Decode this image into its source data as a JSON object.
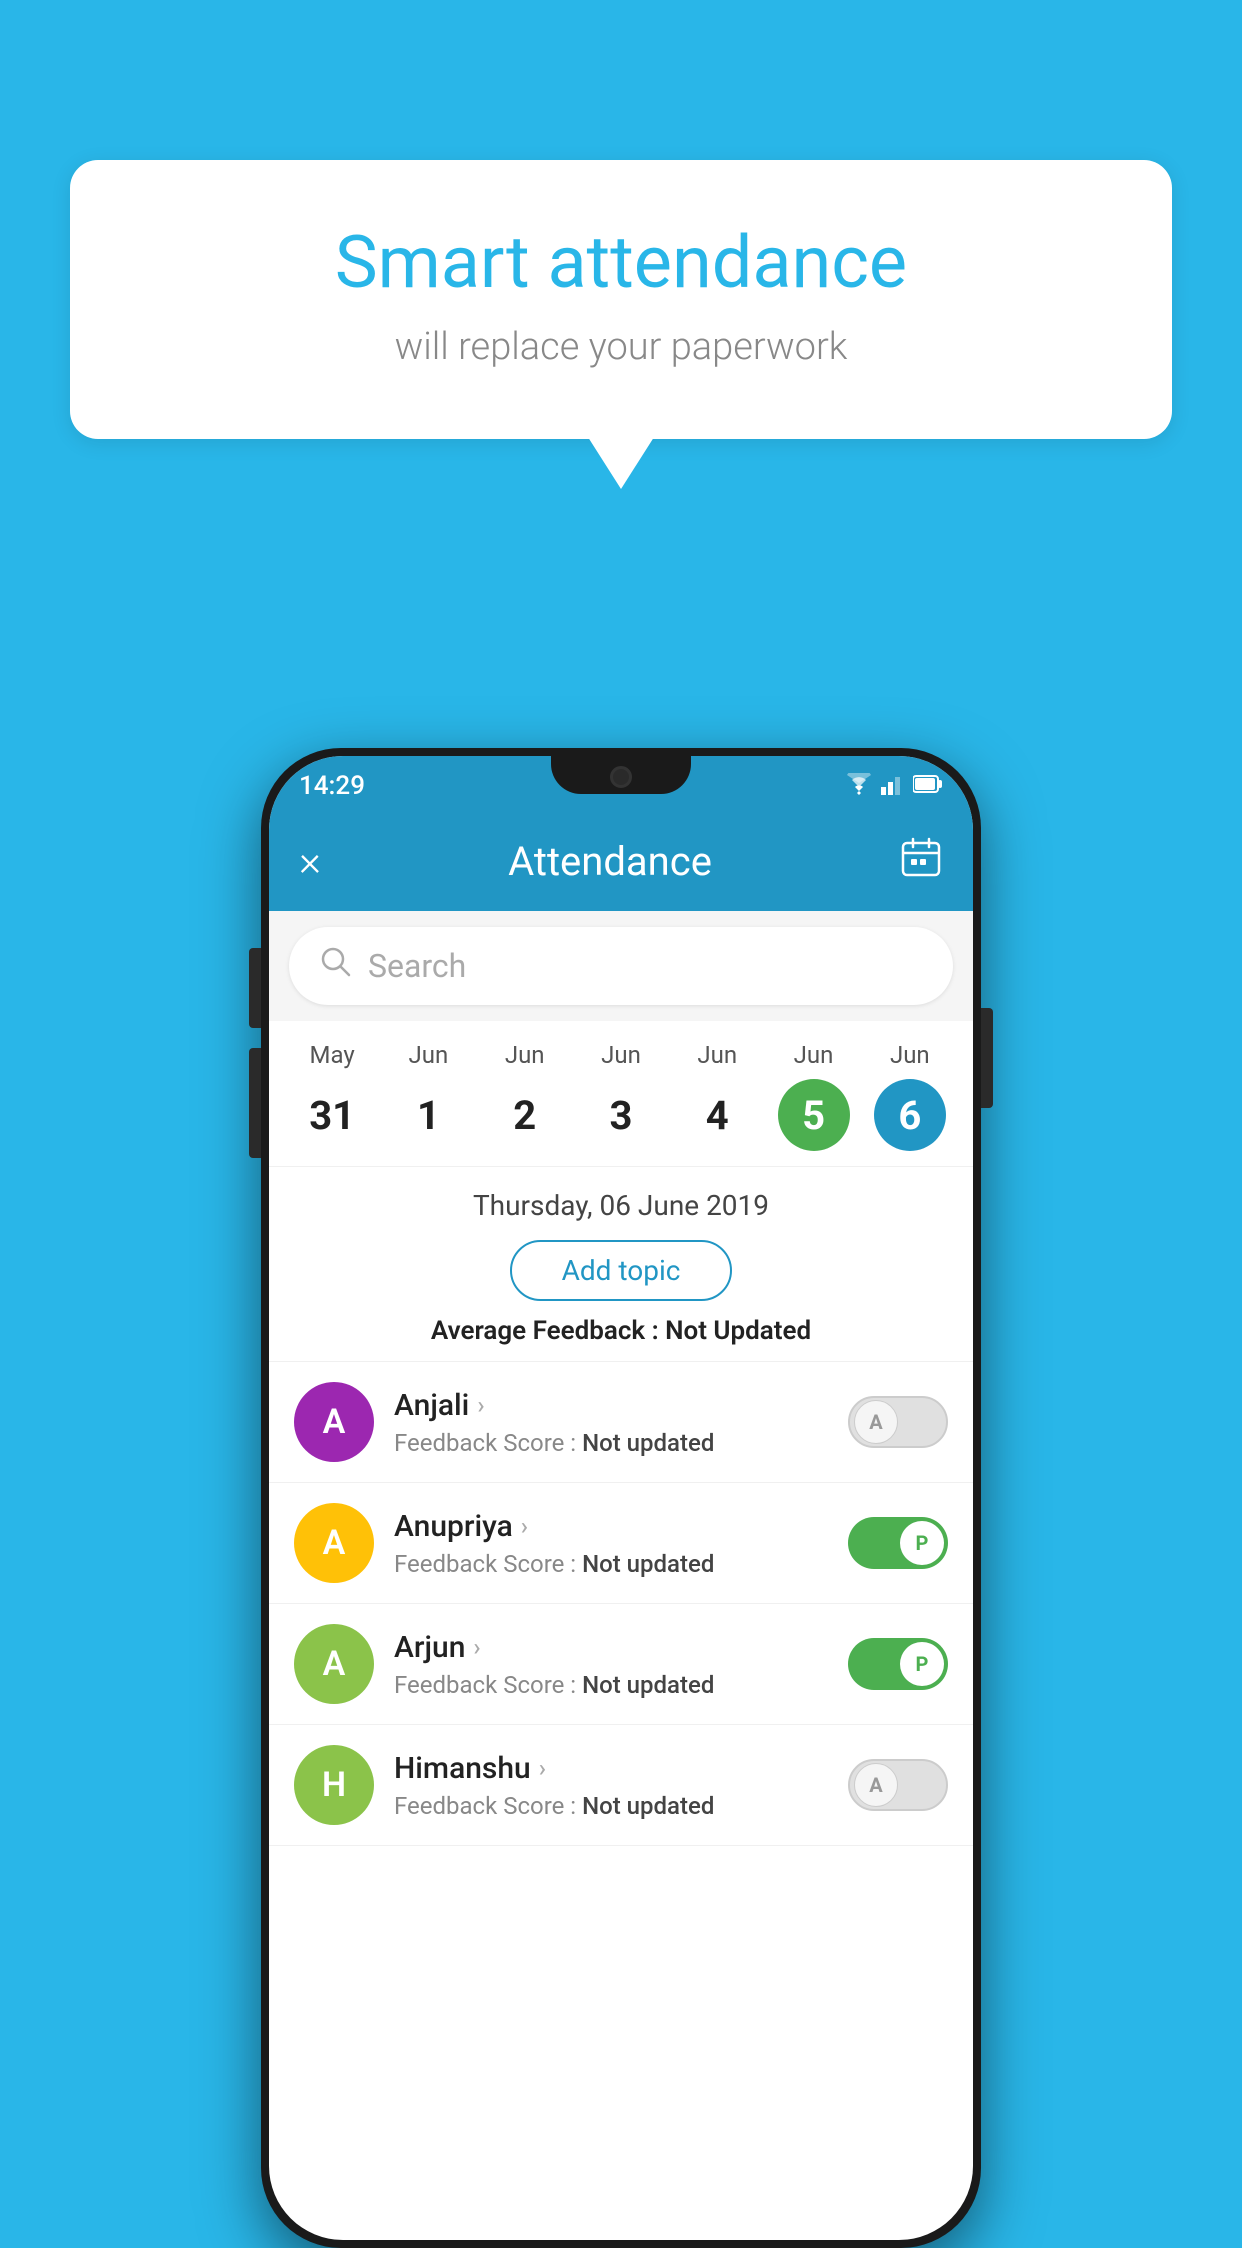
{
  "background_color": "#29b6e8",
  "speech_bubble": {
    "title": "Smart attendance",
    "subtitle": "will replace your paperwork"
  },
  "status_bar": {
    "time": "14:29",
    "wifi_icon": "▼",
    "signal_icon": "◀",
    "battery_icon": "▮"
  },
  "header": {
    "title": "Attendance",
    "close_label": "×",
    "calendar_icon": "📅"
  },
  "search": {
    "placeholder": "Search"
  },
  "calendar": {
    "days": [
      {
        "month": "May",
        "date": "31",
        "state": "normal"
      },
      {
        "month": "Jun",
        "date": "1",
        "state": "normal"
      },
      {
        "month": "Jun",
        "date": "2",
        "state": "normal"
      },
      {
        "month": "Jun",
        "date": "3",
        "state": "normal"
      },
      {
        "month": "Jun",
        "date": "4",
        "state": "normal"
      },
      {
        "month": "Jun",
        "date": "5",
        "state": "today"
      },
      {
        "month": "Jun",
        "date": "6",
        "state": "selected"
      }
    ]
  },
  "date_section": {
    "full_date": "Thursday, 06 June 2019",
    "add_topic_label": "Add topic",
    "avg_feedback_label": "Average Feedback : ",
    "avg_feedback_value": "Not Updated"
  },
  "students": [
    {
      "name": "Anjali",
      "avatar_letter": "A",
      "avatar_color": "avatar-purple",
      "feedback_label": "Feedback Score : ",
      "feedback_value": "Not updated",
      "attendance": "absent",
      "toggle_label": "A"
    },
    {
      "name": "Anupriya",
      "avatar_letter": "A",
      "avatar_color": "avatar-yellow",
      "feedback_label": "Feedback Score : ",
      "feedback_value": "Not updated",
      "attendance": "present",
      "toggle_label": "P"
    },
    {
      "name": "Arjun",
      "avatar_letter": "A",
      "avatar_color": "avatar-green",
      "feedback_label": "Feedback Score : ",
      "feedback_value": "Not updated",
      "attendance": "present",
      "toggle_label": "P"
    },
    {
      "name": "Himanshu",
      "avatar_letter": "H",
      "avatar_color": "avatar-teal",
      "feedback_label": "Feedback Score : ",
      "feedback_value": "Not updated",
      "attendance": "absent",
      "toggle_label": "A"
    }
  ]
}
